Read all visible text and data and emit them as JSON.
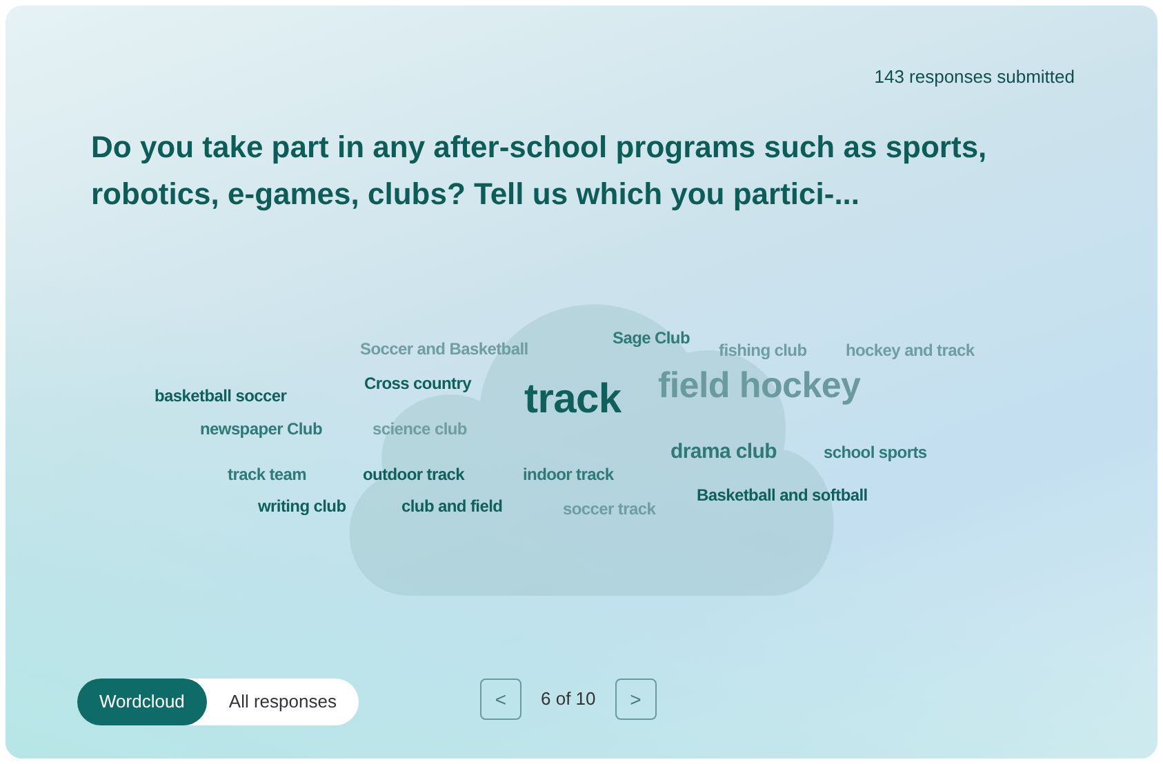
{
  "response_count": "143 responses submitted",
  "question": "Do you take part in any after-school programs such as sports, robotics, e-games, clubs? Tell us which you partici-...",
  "words": [
    {
      "text": "Soccer and Basketball",
      "color": "#6f9ea1"
    },
    {
      "text": "Sage Club",
      "color": "#2f7a79"
    },
    {
      "text": "fishing club",
      "color": "#6f9ea1"
    },
    {
      "text": "hockey and track",
      "color": "#6f9ea1"
    },
    {
      "text": "basketball soccer",
      "color": "#0f5f5c"
    },
    {
      "text": "Cross country",
      "color": "#0f5f5c"
    },
    {
      "text": "track",
      "color": "#0f5f5c"
    },
    {
      "text": "field hockey",
      "color": "#6a9a9d"
    },
    {
      "text": "newspaper Club",
      "color": "#2f7a79"
    },
    {
      "text": "science club",
      "color": "#6f9ea1"
    },
    {
      "text": "drama club",
      "color": "#2f7a79"
    },
    {
      "text": "school sports",
      "color": "#2f7a79"
    },
    {
      "text": "track team",
      "color": "#2f7a79"
    },
    {
      "text": "outdoor track",
      "color": "#0f5f5c"
    },
    {
      "text": "indoor track",
      "color": "#2f7a79"
    },
    {
      "text": "writing club",
      "color": "#0f5f5c"
    },
    {
      "text": "club and field",
      "color": "#0f5f5c"
    },
    {
      "text": "soccer track",
      "color": "#6f9ea1"
    },
    {
      "text": "Basketball and softball",
      "color": "#0f5f5c"
    }
  ],
  "view_tabs": [
    {
      "label": "Wordcloud",
      "selected": true
    },
    {
      "label": "All responses",
      "selected": false
    }
  ],
  "pager": {
    "prev": "<",
    "position": "6 of 10",
    "next": ">"
  }
}
